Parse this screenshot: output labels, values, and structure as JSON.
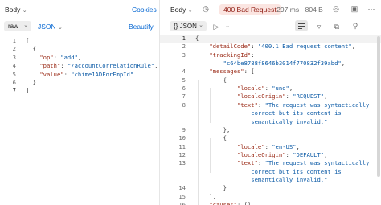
{
  "request": {
    "body_tab": "Body",
    "cookies": "Cookies",
    "format": "raw",
    "language": "JSON",
    "beautify": "Beautify",
    "lines": [
      {
        "n": "1",
        "t": [
          [
            "p",
            "["
          ]
        ]
      },
      {
        "n": "2",
        "t": [
          [
            "p",
            "  {"
          ]
        ]
      },
      {
        "n": "3",
        "t": [
          [
            "p",
            "    "
          ],
          [
            "k",
            "\"op\""
          ],
          [
            "p",
            ": "
          ],
          [
            "s",
            "\"add\""
          ],
          [
            "p",
            ","
          ]
        ]
      },
      {
        "n": "4",
        "t": [
          [
            "p",
            "    "
          ],
          [
            "k",
            "\"path\""
          ],
          [
            "p",
            ": "
          ],
          [
            "s",
            "\"/accountCorrelationRule\""
          ],
          [
            "p",
            ","
          ]
        ]
      },
      {
        "n": "5",
        "t": [
          [
            "p",
            "    "
          ],
          [
            "k",
            "\"value\""
          ],
          [
            "p",
            ": "
          ],
          [
            "s",
            "\"chime1ADForEmpId\""
          ]
        ]
      },
      {
        "n": "6",
        "t": [
          [
            "p",
            "  }"
          ]
        ]
      },
      {
        "n": "7",
        "t": [
          [
            "p",
            "]"
          ]
        ]
      }
    ]
  },
  "response": {
    "body_tab": "Body",
    "status": "400 Bad Request",
    "time": "297 ms",
    "size": "804 B",
    "format": "{} JSON",
    "lines": [
      {
        "n": "1",
        "t": [
          [
            "p",
            "{"
          ]
        ]
      },
      {
        "n": "2",
        "t": [
          [
            "p",
            "    "
          ],
          [
            "k",
            "\"detailCode\""
          ],
          [
            "p",
            ": "
          ],
          [
            "s",
            "\"400.1 Bad request content\""
          ],
          [
            "p",
            ","
          ]
        ]
      },
      {
        "n": "3",
        "t": [
          [
            "p",
            "    "
          ],
          [
            "k",
            "\"trackingId\""
          ],
          [
            "p",
            ":"
          ]
        ]
      },
      {
        "n": "",
        "t": [
          [
            "s",
            "        \"c64be8788f8646b3014f770832f39abd\""
          ],
          [
            "p",
            ","
          ]
        ]
      },
      {
        "n": "4",
        "t": [
          [
            "p",
            "    "
          ],
          [
            "k",
            "\"messages\""
          ],
          [
            "p",
            ": ["
          ]
        ]
      },
      {
        "n": "5",
        "t": [
          [
            "p",
            "        {"
          ]
        ]
      },
      {
        "n": "6",
        "t": [
          [
            "p",
            "            "
          ],
          [
            "k",
            "\"locale\""
          ],
          [
            "p",
            ": "
          ],
          [
            "s",
            "\"und\""
          ],
          [
            "p",
            ","
          ]
        ]
      },
      {
        "n": "7",
        "t": [
          [
            "p",
            "            "
          ],
          [
            "k",
            "\"localeOrigin\""
          ],
          [
            "p",
            ": "
          ],
          [
            "s",
            "\"REQUEST\""
          ],
          [
            "p",
            ","
          ]
        ]
      },
      {
        "n": "8",
        "t": [
          [
            "p",
            "            "
          ],
          [
            "k",
            "\"text\""
          ],
          [
            "p",
            ": "
          ],
          [
            "s",
            "\"The request was syntactically"
          ]
        ]
      },
      {
        "n": "",
        "t": [
          [
            "s",
            "                correct but its content is"
          ]
        ]
      },
      {
        "n": "",
        "t": [
          [
            "s",
            "                semantically invalid.\""
          ]
        ]
      },
      {
        "n": "9",
        "t": [
          [
            "p",
            "        },"
          ]
        ]
      },
      {
        "n": "10",
        "t": [
          [
            "p",
            "        {"
          ]
        ]
      },
      {
        "n": "11",
        "t": [
          [
            "p",
            "            "
          ],
          [
            "k",
            "\"locale\""
          ],
          [
            "p",
            ": "
          ],
          [
            "s",
            "\"en-US\""
          ],
          [
            "p",
            ","
          ]
        ]
      },
      {
        "n": "12",
        "t": [
          [
            "p",
            "            "
          ],
          [
            "k",
            "\"localeOrigin\""
          ],
          [
            "p",
            ": "
          ],
          [
            "s",
            "\"DEFAULT\""
          ],
          [
            "p",
            ","
          ]
        ]
      },
      {
        "n": "13",
        "t": [
          [
            "p",
            "            "
          ],
          [
            "k",
            "\"text\""
          ],
          [
            "p",
            ": "
          ],
          [
            "s",
            "\"The request was syntactically"
          ]
        ]
      },
      {
        "n": "",
        "t": [
          [
            "s",
            "                correct but its content is"
          ]
        ]
      },
      {
        "n": "",
        "t": [
          [
            "s",
            "                semantically invalid.\""
          ]
        ]
      },
      {
        "n": "14",
        "t": [
          [
            "p",
            "        }"
          ]
        ]
      },
      {
        "n": "15",
        "t": [
          [
            "p",
            "    ],"
          ]
        ]
      },
      {
        "n": "16",
        "t": [
          [
            "p",
            "    "
          ],
          [
            "k",
            "\"causes\""
          ],
          [
            "p",
            ": []"
          ]
        ]
      }
    ]
  },
  "icons": {
    "history": "history-icon",
    "save": "save-response-icon",
    "more": "more-icon",
    "filter": "filter-icon",
    "copy": "copy-icon",
    "search": "search-icon",
    "wrap": "wrap-lines-icon",
    "play": "visualize-icon",
    "chevron": "chevron-down-icon"
  }
}
